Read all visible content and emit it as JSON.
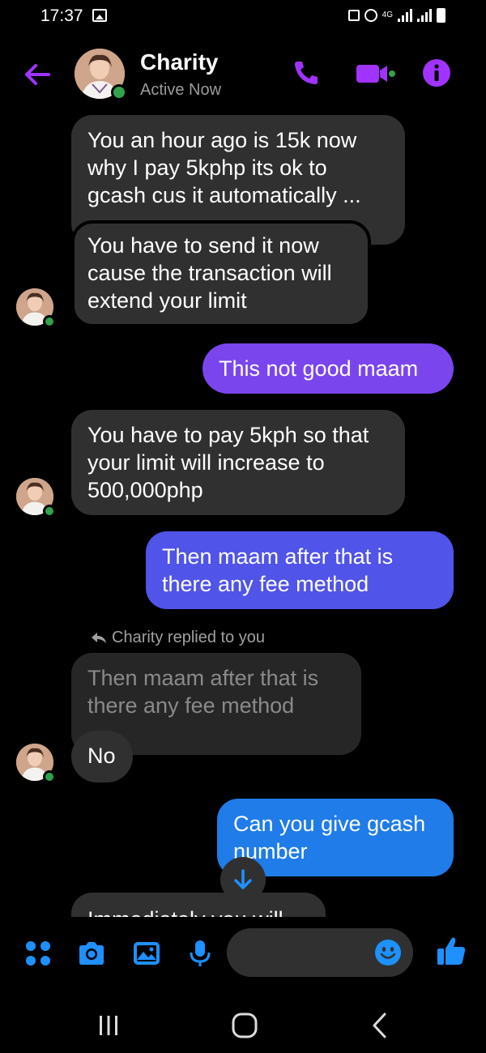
{
  "status_bar": {
    "time": "17:37",
    "network": "4G"
  },
  "header": {
    "name": "Charity",
    "status": "Active Now"
  },
  "messages": [
    {
      "sender": "Charity",
      "type": "received",
      "text": "You an hour ago is 15k now why  I pay 5kphp its ok to gcash cus it automatically  ..."
    },
    {
      "sender": "Charity",
      "type": "received",
      "text": "You have to send it now cause the transaction will extend your limit"
    },
    {
      "sender": "me",
      "type": "sent",
      "text": "This not good maam"
    },
    {
      "sender": "Charity",
      "type": "received",
      "text": "You have to pay 5kph so that your limit will increase to 500,000php"
    },
    {
      "sender": "me",
      "type": "sent",
      "text": "Then maam  after that is there  any fee method"
    },
    {
      "sender": "Charity",
      "type": "reply_note",
      "text": "Charity replied to you"
    },
    {
      "sender": "Charity",
      "type": "quoted",
      "text": "Then maam  after that is there  any fee method"
    },
    {
      "sender": "Charity",
      "type": "received",
      "text": "No"
    },
    {
      "sender": "me",
      "type": "sent",
      "text": "Can you give gcash number"
    },
    {
      "sender": "Charity",
      "type": "received",
      "text": "Immediately  you will"
    }
  ],
  "colors": {
    "accent": "#a033ff",
    "received_bubble": "#303030",
    "sent_bubble_top": "#7b45ee",
    "sent_bubble_mid": "#5054e8",
    "sent_bubble_bottom": "#1f7ce8",
    "active": "#31a24c",
    "composer_icons": "#1e90ff"
  },
  "composer": {
    "icons": [
      "apps-icon",
      "camera-icon",
      "gallery-icon",
      "microphone-icon",
      "emoji-icon",
      "thumbs-up-icon"
    ],
    "placeholder": ""
  },
  "navigation": [
    "recent-apps-icon",
    "home-icon",
    "back-icon"
  ]
}
